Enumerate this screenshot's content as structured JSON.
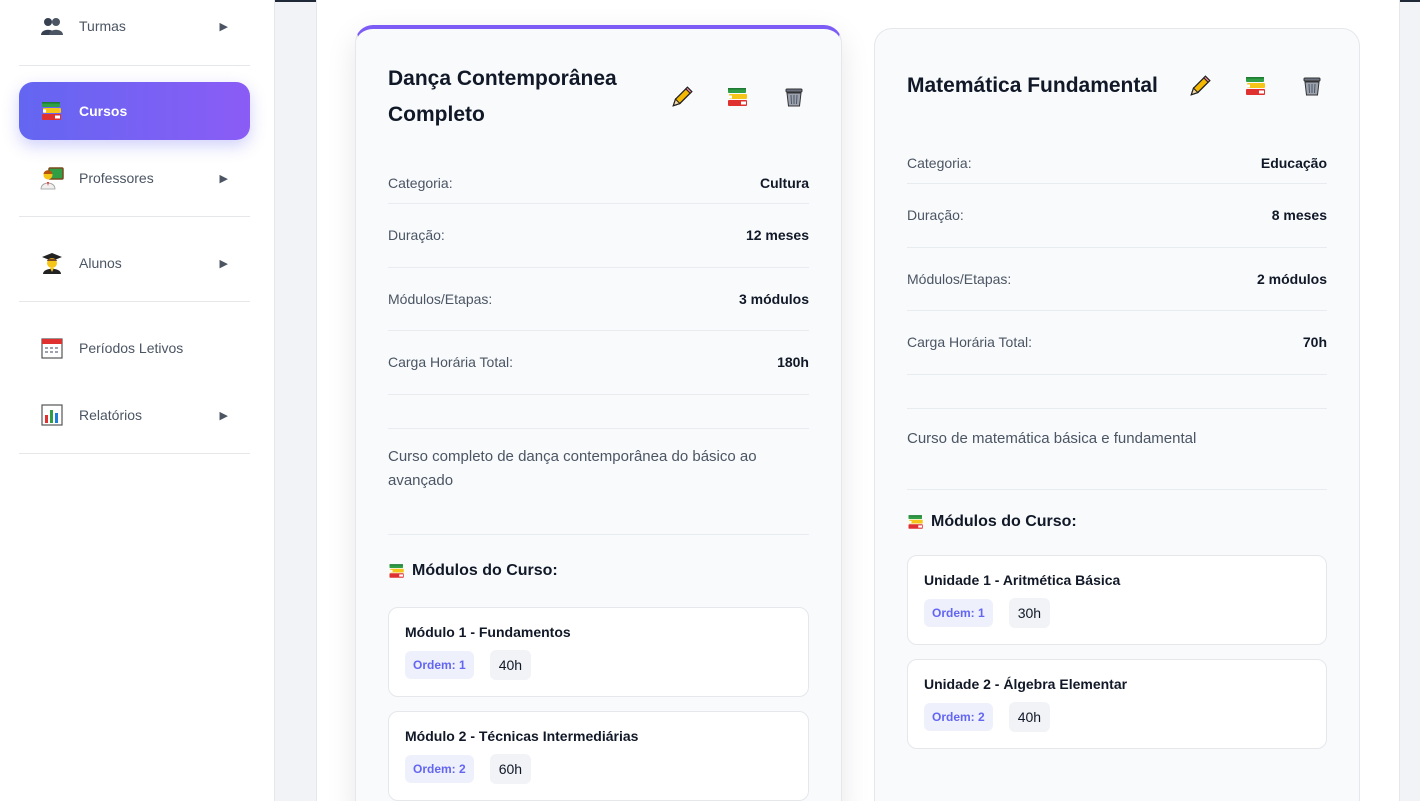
{
  "sidebar": {
    "items": [
      {
        "label": "Turmas",
        "icon": "group-icon",
        "arrow": "▶"
      },
      {
        "label": "Cursos",
        "icon": "books-icon",
        "active": true
      },
      {
        "label": "Professores",
        "icon": "teacher-icon",
        "arrow": "▶"
      },
      {
        "label": "Alunos",
        "icon": "student-icon",
        "arrow": "▶"
      },
      {
        "label": "Períodos Letivos",
        "icon": "calendar-icon"
      },
      {
        "label": "Relatórios",
        "icon": "bar-chart-icon",
        "arrow": "▶"
      }
    ]
  },
  "courses": [
    {
      "title": "Dança Contemporânea Completo",
      "fields": [
        {
          "label": "Categoria:",
          "value": "Cultura"
        },
        {
          "label": "Duração:",
          "value": "12 meses"
        },
        {
          "label": "Módulos/Etapas:",
          "value": "3 módulos"
        },
        {
          "label": "Carga Horária Total:",
          "value": "180h"
        }
      ],
      "description": "Curso completo de dança contemporânea do básico ao avançado",
      "modules_heading": "Módulos do Curso:",
      "modules": [
        {
          "title": "Módulo 1 - Fundamentos",
          "order": "Ordem: 1",
          "hours": "40h"
        },
        {
          "title": "Módulo 2 - Técnicas Intermediárias",
          "order": "Ordem: 2",
          "hours": "60h"
        }
      ]
    },
    {
      "title": "Matemática Fundamental",
      "fields": [
        {
          "label": "Categoria:",
          "value": "Educação"
        },
        {
          "label": "Duração:",
          "value": "8 meses"
        },
        {
          "label": "Módulos/Etapas:",
          "value": "2 módulos"
        },
        {
          "label": "Carga Horária Total:",
          "value": "70h"
        }
      ],
      "description": "Curso de matemática básica e fundamental",
      "modules_heading": "Módulos do Curso:",
      "modules": [
        {
          "title": "Unidade 1 - Aritmética Básica",
          "order": "Ordem: 1",
          "hours": "30h"
        },
        {
          "title": "Unidade 2 - Álgebra Elementar",
          "order": "Ordem: 2",
          "hours": "40h"
        }
      ]
    }
  ],
  "colors": {
    "accent": "#6366f1",
    "accent_end": "#8b5cf6",
    "card_bg": "#f8fafc"
  }
}
